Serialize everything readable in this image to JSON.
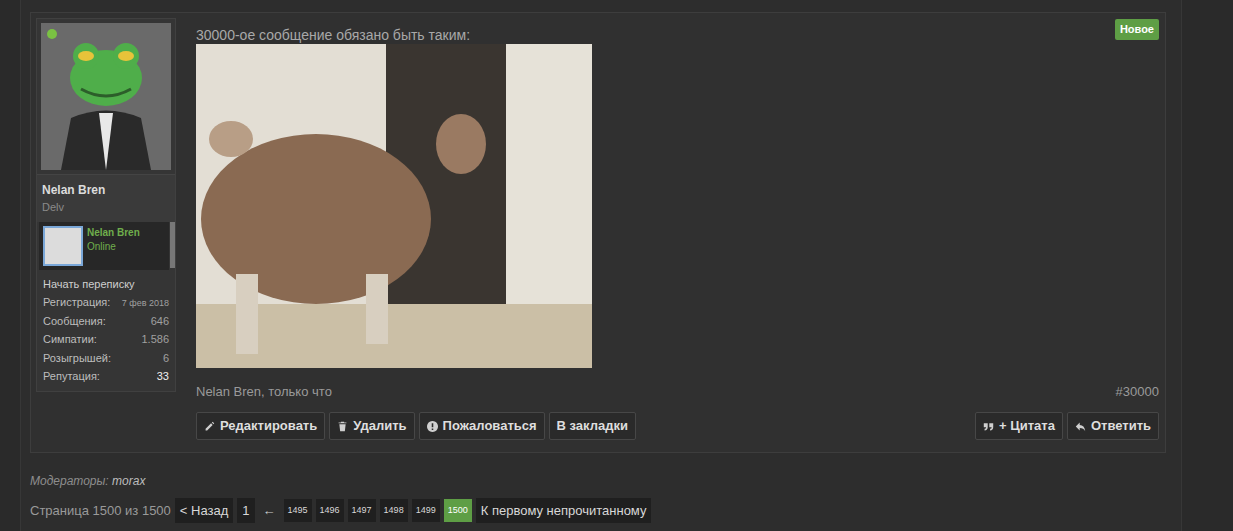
{
  "user": {
    "name": "Nelan Bren",
    "title": "Delv",
    "online": true,
    "card": {
      "name": "Nelan Bren",
      "status": "Online"
    },
    "start_conversation": "Начать переписку",
    "stats": [
      {
        "label": "Регистрация:",
        "value": "7 фев 2018",
        "emphasis": false,
        "kind": "small"
      },
      {
        "label": "Сообщения:",
        "value": "646",
        "emphasis": false,
        "kind": "normal"
      },
      {
        "label": "Симпатии:",
        "value": "1.586",
        "emphasis": false,
        "kind": "normal"
      },
      {
        "label": "Розыгрышей:",
        "value": "6",
        "emphasis": false,
        "kind": "normal"
      },
      {
        "label": "Репутация:",
        "value": "33",
        "emphasis": true,
        "kind": "normal"
      }
    ]
  },
  "post": {
    "text": "30000-ое сообщение обязано быть таким:",
    "badge": "Новое",
    "meta": "Nelan Bren, только что",
    "number": "#30000",
    "actions_left": [
      "Редактировать",
      "Удалить",
      "Пожаловаться",
      "В закладки"
    ],
    "actions_right": [
      "+ Цитата",
      "Ответить"
    ]
  },
  "moderators": {
    "label": "Модераторы:",
    "names": [
      "morax"
    ]
  },
  "pagination": {
    "summary": "Страница 1500 из 1500",
    "prev": "< Назад",
    "first": {
      "label": "1",
      "selected": false
    },
    "gap": "←",
    "pages": [
      {
        "label": "1495",
        "selected": false
      },
      {
        "label": "1496",
        "selected": false
      },
      {
        "label": "1497",
        "selected": false
      },
      {
        "label": "1498",
        "selected": false
      },
      {
        "label": "1499",
        "selected": false
      },
      {
        "label": "1500",
        "selected": true
      }
    ],
    "unread": "К первому непрочитанному"
  }
}
